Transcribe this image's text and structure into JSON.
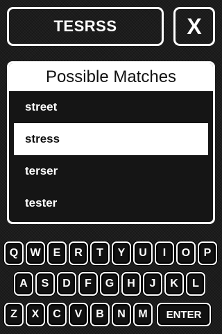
{
  "header": {
    "word": "TESRSS",
    "clear_label": "X"
  },
  "matches": {
    "title": "Possible Matches",
    "items": [
      {
        "label": "street",
        "selected": false
      },
      {
        "label": "stress",
        "selected": true
      },
      {
        "label": "terser",
        "selected": false
      },
      {
        "label": "tester",
        "selected": false
      }
    ]
  },
  "keyboard": {
    "rows": [
      [
        "Q",
        "W",
        "E",
        "R",
        "T",
        "Y",
        "U",
        "I",
        "O",
        "P"
      ],
      [
        "A",
        "S",
        "D",
        "F",
        "G",
        "H",
        "J",
        "K",
        "L"
      ],
      [
        "Z",
        "X",
        "C",
        "V",
        "B",
        "N",
        "M"
      ]
    ],
    "enter_label": "ENTER"
  },
  "colors": {
    "background": "#1c1c1c",
    "foreground": "#ffffff",
    "selected_bg": "#ffffff",
    "selected_text": "#111111"
  }
}
